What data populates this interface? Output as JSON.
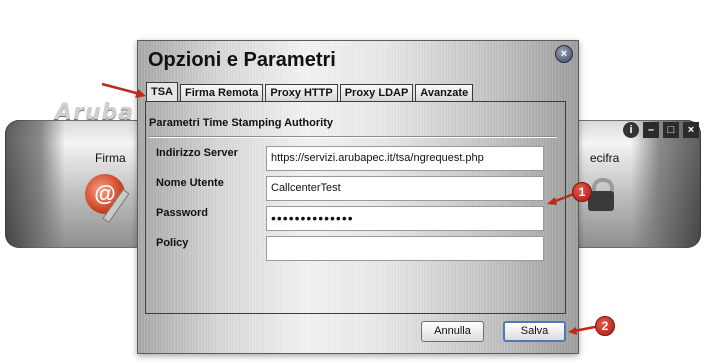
{
  "background_app": {
    "logo": "Aruba",
    "firma_label": "Firma",
    "cifra_label": "ecifra",
    "window_controls": [
      "info-icon",
      "minimize-icon",
      "maximize-icon",
      "close-icon"
    ]
  },
  "dialog": {
    "title": "Opzioni e Parametri",
    "close_glyph": "×",
    "tabs": [
      {
        "label": "TSA",
        "active": true
      },
      {
        "label": "Firma Remota",
        "active": false
      },
      {
        "label": "Proxy HTTP",
        "active": false
      },
      {
        "label": "Proxy LDAP",
        "active": false
      },
      {
        "label": "Avanzate",
        "active": false
      }
    ],
    "section_title": "Parametri Time Stamping Authority",
    "fields": {
      "server": {
        "label": "Indirizzo Server",
        "value": "https://servizi.arubapec.it/tsa/ngrequest.php"
      },
      "username": {
        "label": "Nome Utente",
        "value": "CallcenterTest"
      },
      "password": {
        "label": "Password",
        "value": "••••••••••••••"
      },
      "policy": {
        "label": "Policy",
        "value": ""
      }
    },
    "buttons": {
      "cancel": "Annulla",
      "save": "Salva"
    }
  },
  "annotations": {
    "badge_1": "1",
    "badge_2": "2",
    "color": "#c0281c"
  }
}
